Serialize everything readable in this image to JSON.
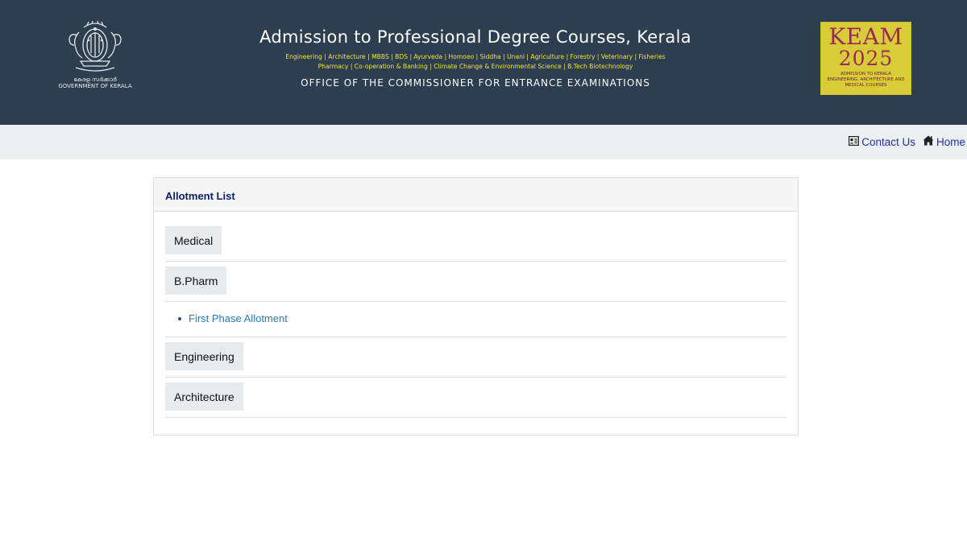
{
  "header": {
    "emblem": {
      "caption_ml": "കേരള സർക്കാർ",
      "caption_en": "GOVERNMENT OF KERALA"
    },
    "title": "Admission to Professional Degree Courses, Kerala",
    "courses_line1": "Engineering | Architecture | MBBS | BDS | Ayurveda | Homoeo | Siddha | Unani | Agriculture | Forestry | Veterinary | Fisheries",
    "courses_line2": "Pharmacy | Co-operation & Banking | Climate Change & Environmental Science | B.Tech Biotechnology",
    "office": "OFFICE OF THE COMMISSIONER FOR ENTRANCE EXAMINATIONS",
    "keam_logo": {
      "name": "KEAM",
      "year": "2025",
      "tagline": "ADMISSION TO KERALA ENGINEERING, ARCHITECTURE AND MEDICAL COURSES"
    }
  },
  "nav": {
    "contact": {
      "label": "Contact Us",
      "icon": "contact-card-icon"
    },
    "home": {
      "label": "Home",
      "icon": "home-icon"
    }
  },
  "panel": {
    "title": "Allotment List",
    "categories": [
      {
        "label": "Medical"
      },
      {
        "label": "B.Pharm",
        "items": [
          "First Phase Allotment"
        ]
      },
      {
        "label": "Engineering"
      },
      {
        "label": "Architecture"
      }
    ]
  },
  "colors": {
    "header_bg": "#2c3e50",
    "navbar_bg": "#ecf0f1",
    "courses_text": "#f3e23a",
    "link": "#2a7ab8",
    "nav_link": "#1f2fb0",
    "keam_bg": "#d8cd39",
    "keam_text": "#9a2a55"
  }
}
